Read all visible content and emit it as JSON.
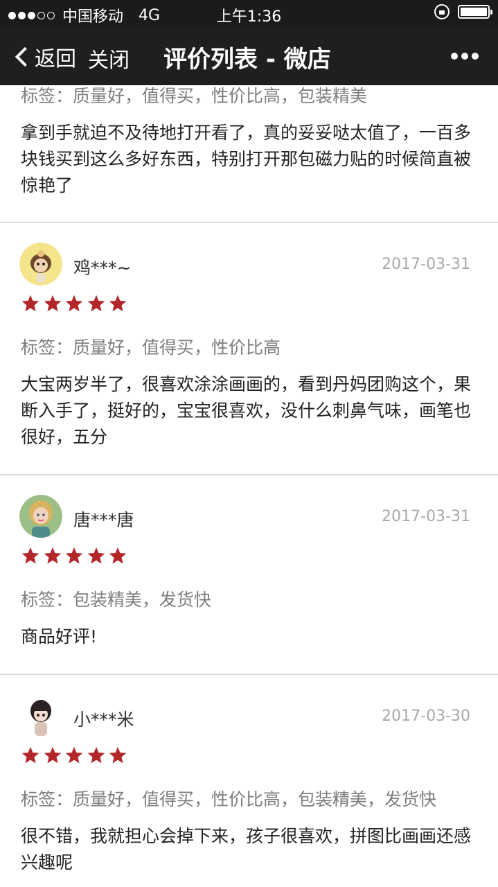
{
  "status": {
    "carrier": "中国移动",
    "network": "4G",
    "time": "上午1:36"
  },
  "nav": {
    "back_label": "返回",
    "close_label": "关闭",
    "title": "评价列表 - 微店"
  },
  "reviews": [
    {
      "tags": "标签：质量好，值得买，性价比高，包装精美",
      "text": "拿到手就迫不及待地打开看了，真的妥妥哒太值了，一百多块钱买到这么多好东西，特别打开那包磁力贴的时候简直被惊艳了"
    },
    {
      "user": "鸡***~",
      "date": "2017-03-31",
      "rating": 5,
      "tags": "标签：质量好，值得买，性价比高",
      "text": "大宝两岁半了，很喜欢涂涂画画的，看到丹妈团购这个，果断入手了，挺好的，宝宝很喜欢，没什么刺鼻气味，画笔也很好，五分"
    },
    {
      "user": "唐***唐",
      "date": "2017-03-31",
      "rating": 5,
      "tags": "标签：包装精美，发货快",
      "text": "商品好评!"
    },
    {
      "user": "小***米",
      "date": "2017-03-30",
      "rating": 5,
      "tags": "标签：质量好，值得买，性价比高，包装精美，发货快",
      "text": "很不错，我就担心会掉下来，孩子很喜欢，拼图比画画还感兴趣呢"
    }
  ],
  "colors": {
    "star": "#b3262a",
    "date": "#a8a8a8",
    "tags": "#7d7d7d",
    "nav_bg": "#1f1f1f"
  }
}
